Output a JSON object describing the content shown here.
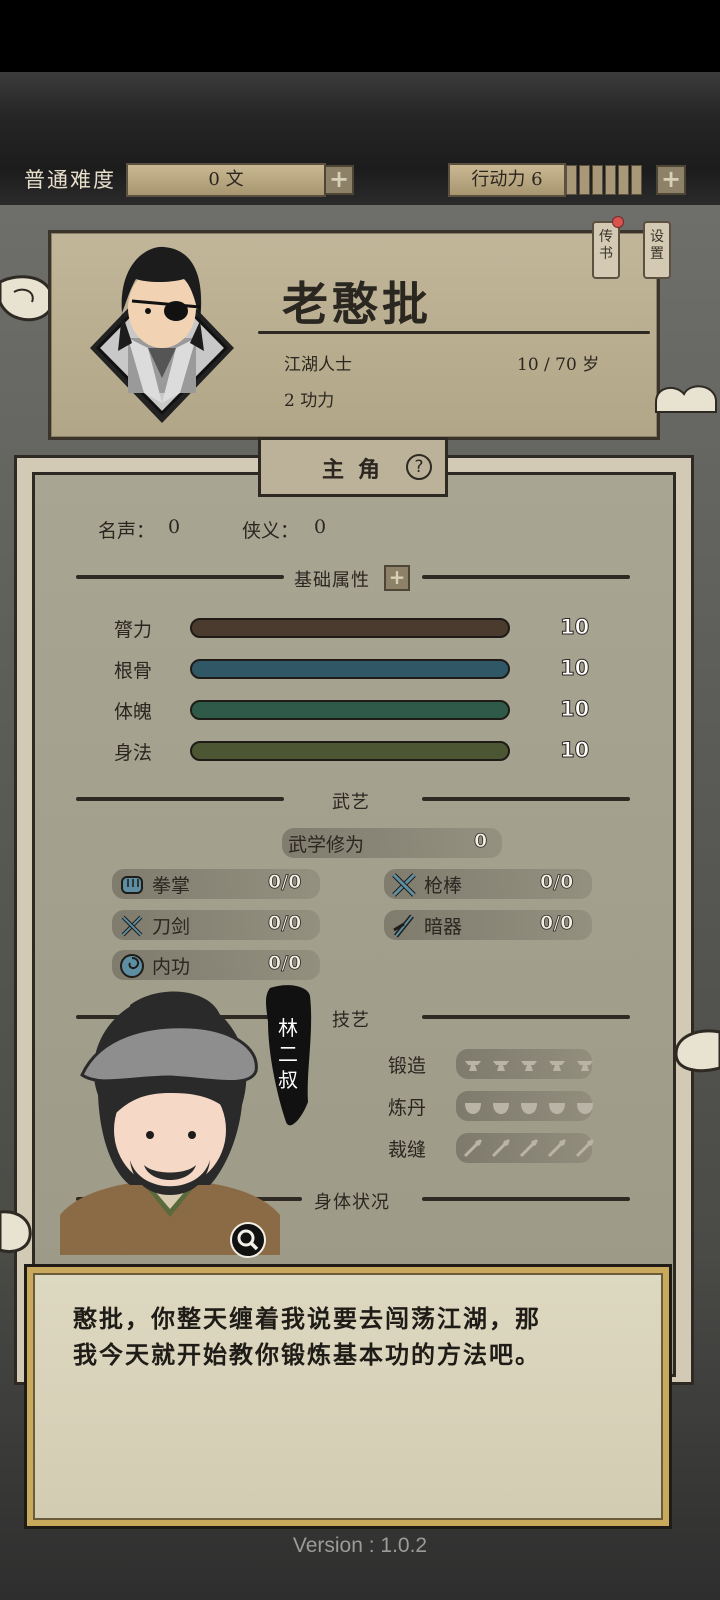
{
  "top_bar": {
    "difficulty": "普通难度",
    "currency": "0 文",
    "action_points": "行动力 6",
    "action_points_value": 6
  },
  "profile": {
    "name": "老憨批",
    "title": "江湖人士",
    "age": "10 / 70 岁",
    "power": "2 功力",
    "tags": [
      "传书",
      "设置"
    ],
    "has_notification": true
  },
  "panel": {
    "tab": "主角",
    "help": "?",
    "fame_label": "名声：",
    "fame_value": "0",
    "justice_label": "侠义：",
    "justice_value": "0",
    "attributes_title": "基础属性",
    "attributes": [
      {
        "name": "膂力",
        "value": "10",
        "color": "#4a3b2e"
      },
      {
        "name": "根骨",
        "value": "10",
        "color": "#2f5766"
      },
      {
        "name": "体魄",
        "value": "10",
        "color": "#2f5a4a"
      },
      {
        "name": "身法",
        "value": "10",
        "color": "#4d5632"
      }
    ],
    "martial_title": "武艺",
    "martial_cultivation_label": "武学修为",
    "martial_cultivation_value": "0",
    "martial_skills": [
      {
        "name": "拳掌",
        "value": "0/0",
        "icon": "fist-icon"
      },
      {
        "name": "枪棒",
        "value": "0/0",
        "icon": "crossed-staff-icon"
      },
      {
        "name": "刀剑",
        "value": "0/0",
        "icon": "crossed-swords-icon"
      },
      {
        "name": "暗器",
        "value": "0/0",
        "icon": "dart-icon"
      },
      {
        "name": "内功",
        "value": "0/0",
        "icon": "swirl-icon"
      }
    ],
    "crafts_title": "技艺",
    "crafts": [
      {
        "name": "锻造",
        "icon": "anvil-icon",
        "rating": 0,
        "max": 5
      },
      {
        "name": "炼丹",
        "icon": "cauldron-icon",
        "rating": 0,
        "max": 5
      },
      {
        "name": "裁缝",
        "icon": "needle-icon",
        "rating": 0,
        "max": 5
      }
    ],
    "body_status_title": "身体状况"
  },
  "npc": {
    "name": "林二叔"
  },
  "dialog": {
    "line1": "憨批，你整天缠着我说要去闯荡江湖，那",
    "line2": "我今天就开始教你锻炼基本功的方法吧。"
  },
  "version": "Version : 1.0.2"
}
